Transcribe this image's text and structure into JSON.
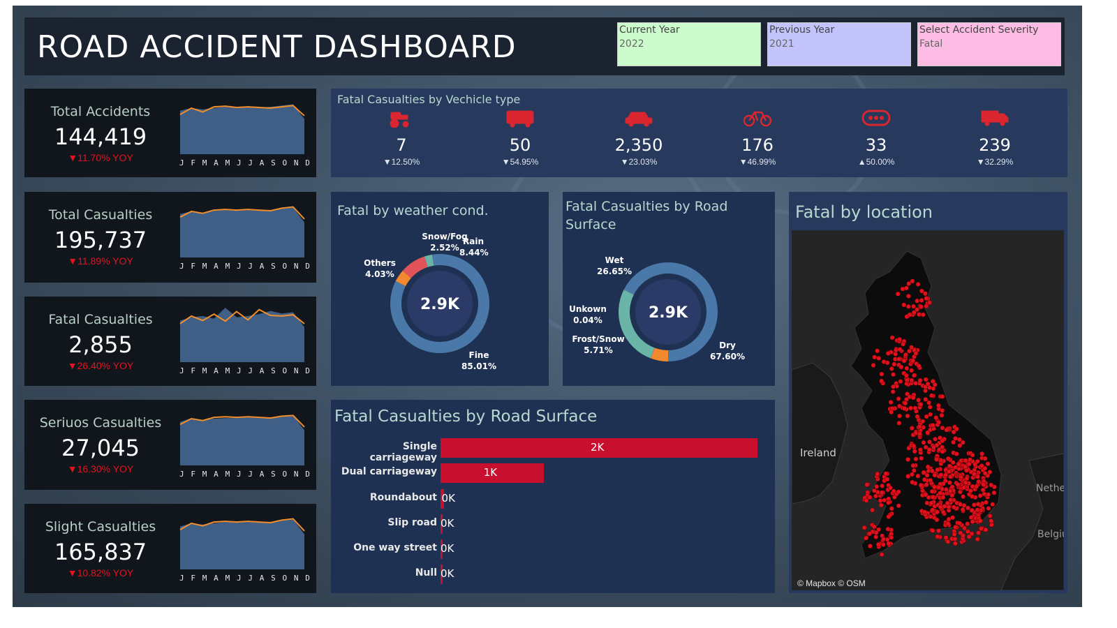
{
  "header": {
    "title": "ROAD ACCIDENT DASHBOARD",
    "filters": [
      {
        "label": "Current Year",
        "value": "2022",
        "color": "#ccfccc"
      },
      {
        "label": "Previous Year",
        "value": "2021",
        "color": "#c4c4fc"
      },
      {
        "label": "Select Accident Severity",
        "value": "Fatal",
        "color": "#fcbce4"
      }
    ]
  },
  "kpis": [
    {
      "label": "Total Accidents",
      "value": "144,419",
      "yoy": "▼11.70% YOY",
      "current": [
        62,
        72,
        66,
        74,
        75,
        73,
        74,
        73,
        72,
        74,
        76,
        60
      ],
      "previous": [
        58,
        62,
        60,
        62,
        64,
        63,
        64,
        63,
        64,
        66,
        68,
        45
      ]
    },
    {
      "label": "Total Casualties",
      "value": "195,737",
      "yoy": "▼11.89% YOY",
      "current": [
        63,
        72,
        69,
        74,
        75,
        74,
        75,
        74,
        73,
        77,
        79,
        60
      ],
      "previous": [
        58,
        62,
        60,
        63,
        64,
        63,
        64,
        63,
        64,
        66,
        68,
        45
      ]
    },
    {
      "label": "Fatal Casualties",
      "value": "2,855",
      "yoy": "▼26.40% YOY",
      "current": [
        60,
        72,
        65,
        75,
        64,
        79,
        66,
        82,
        73,
        72,
        74,
        60
      ],
      "previous": [
        55,
        60,
        62,
        58,
        75,
        60,
        62,
        65,
        70,
        66,
        68,
        45
      ]
    },
    {
      "label": "Seriuos Casualties",
      "value": "27,045",
      "yoy": "▼16.30% YOY",
      "current": [
        64,
        73,
        70,
        75,
        76,
        75,
        76,
        75,
        74,
        77,
        78,
        60
      ],
      "previous": [
        58,
        64,
        61,
        63,
        64,
        64,
        65,
        64,
        64,
        66,
        68,
        45
      ]
    },
    {
      "label": "Slight Casualties",
      "value": "165,837",
      "yoy": "▼10.82% YOY",
      "current": [
        62,
        72,
        68,
        74,
        75,
        74,
        75,
        74,
        73,
        77,
        79,
        60
      ],
      "previous": [
        57,
        62,
        60,
        62,
        64,
        63,
        64,
        63,
        64,
        66,
        68,
        45
      ]
    }
  ],
  "months": [
    "J",
    "F",
    "M",
    "A",
    "M",
    "J",
    "J",
    "A",
    "S",
    "O",
    "N",
    "D"
  ],
  "vehicle": {
    "title": "Fatal Casualties by Vechicle type",
    "items": [
      {
        "icon": "tractor-icon",
        "value": "7",
        "yoy": "▼12.50%"
      },
      {
        "icon": "bus-icon",
        "value": "50",
        "yoy": "▼54.95%"
      },
      {
        "icon": "car-icon",
        "value": "2,350",
        "yoy": "▼23.03%"
      },
      {
        "icon": "bicycle-icon",
        "value": "176",
        "yoy": "▼46.99%"
      },
      {
        "icon": "other-vehicle-icon",
        "value": "33",
        "yoy": "▲50.00%"
      },
      {
        "icon": "van-icon",
        "value": "239",
        "yoy": "▼32.29%"
      }
    ],
    "icon_color": "#d9262f"
  },
  "weather": {
    "title": "Fatal by weather cond.",
    "center": "2.9K",
    "slices": [
      {
        "name": "Fine",
        "pct": 85.01,
        "label": "85.01%",
        "color": "#4a78a8"
      },
      {
        "name": "Others",
        "pct": 4.03,
        "label": "4.03%",
        "color": "#f2892e"
      },
      {
        "name": "Rain",
        "pct": 8.44,
        "label": "8.44%",
        "color": "#e25459"
      },
      {
        "name": "Snow/Fog",
        "pct": 2.52,
        "label": "2.52%",
        "color": "#6bb4a8"
      }
    ]
  },
  "surface": {
    "title": "Fatal Casualties by Road Surface",
    "center": "2.9K",
    "slices": [
      {
        "name": "Dry",
        "pct": 67.6,
        "label": "67.60%",
        "color": "#4a78a8"
      },
      {
        "name": "Frost/Snow",
        "pct": 5.71,
        "label": "5.71%",
        "color": "#f2892e"
      },
      {
        "name": "Unkown",
        "pct": 0.04,
        "label": "0.04%",
        "color": "#e25459"
      },
      {
        "name": "Wet",
        "pct": 26.65,
        "label": "26.65%",
        "color": "#6bb4a8"
      }
    ]
  },
  "road_type": {
    "title": "Fatal Casualties by Road Surface",
    "bars": [
      {
        "label": "Single carriageway",
        "value": 2000,
        "text": "2K"
      },
      {
        "label": "Dual carriageway",
        "value": 650,
        "text": "1K"
      },
      {
        "label": "Roundabout",
        "value": 20,
        "text": "0K"
      },
      {
        "label": "Slip road",
        "value": 6,
        "text": "0K"
      },
      {
        "label": "One way street",
        "value": 4,
        "text": "0K"
      },
      {
        "label": "Null",
        "value": 2,
        "text": "0K"
      }
    ],
    "bar_color": "#c8102e"
  },
  "map": {
    "title": "Fatal by location",
    "labels": {
      "ireland": "Ireland",
      "netherlands": "Nethe",
      "belgium": "Belgiu"
    },
    "attribution": "© Mapbox © OSM"
  }
}
